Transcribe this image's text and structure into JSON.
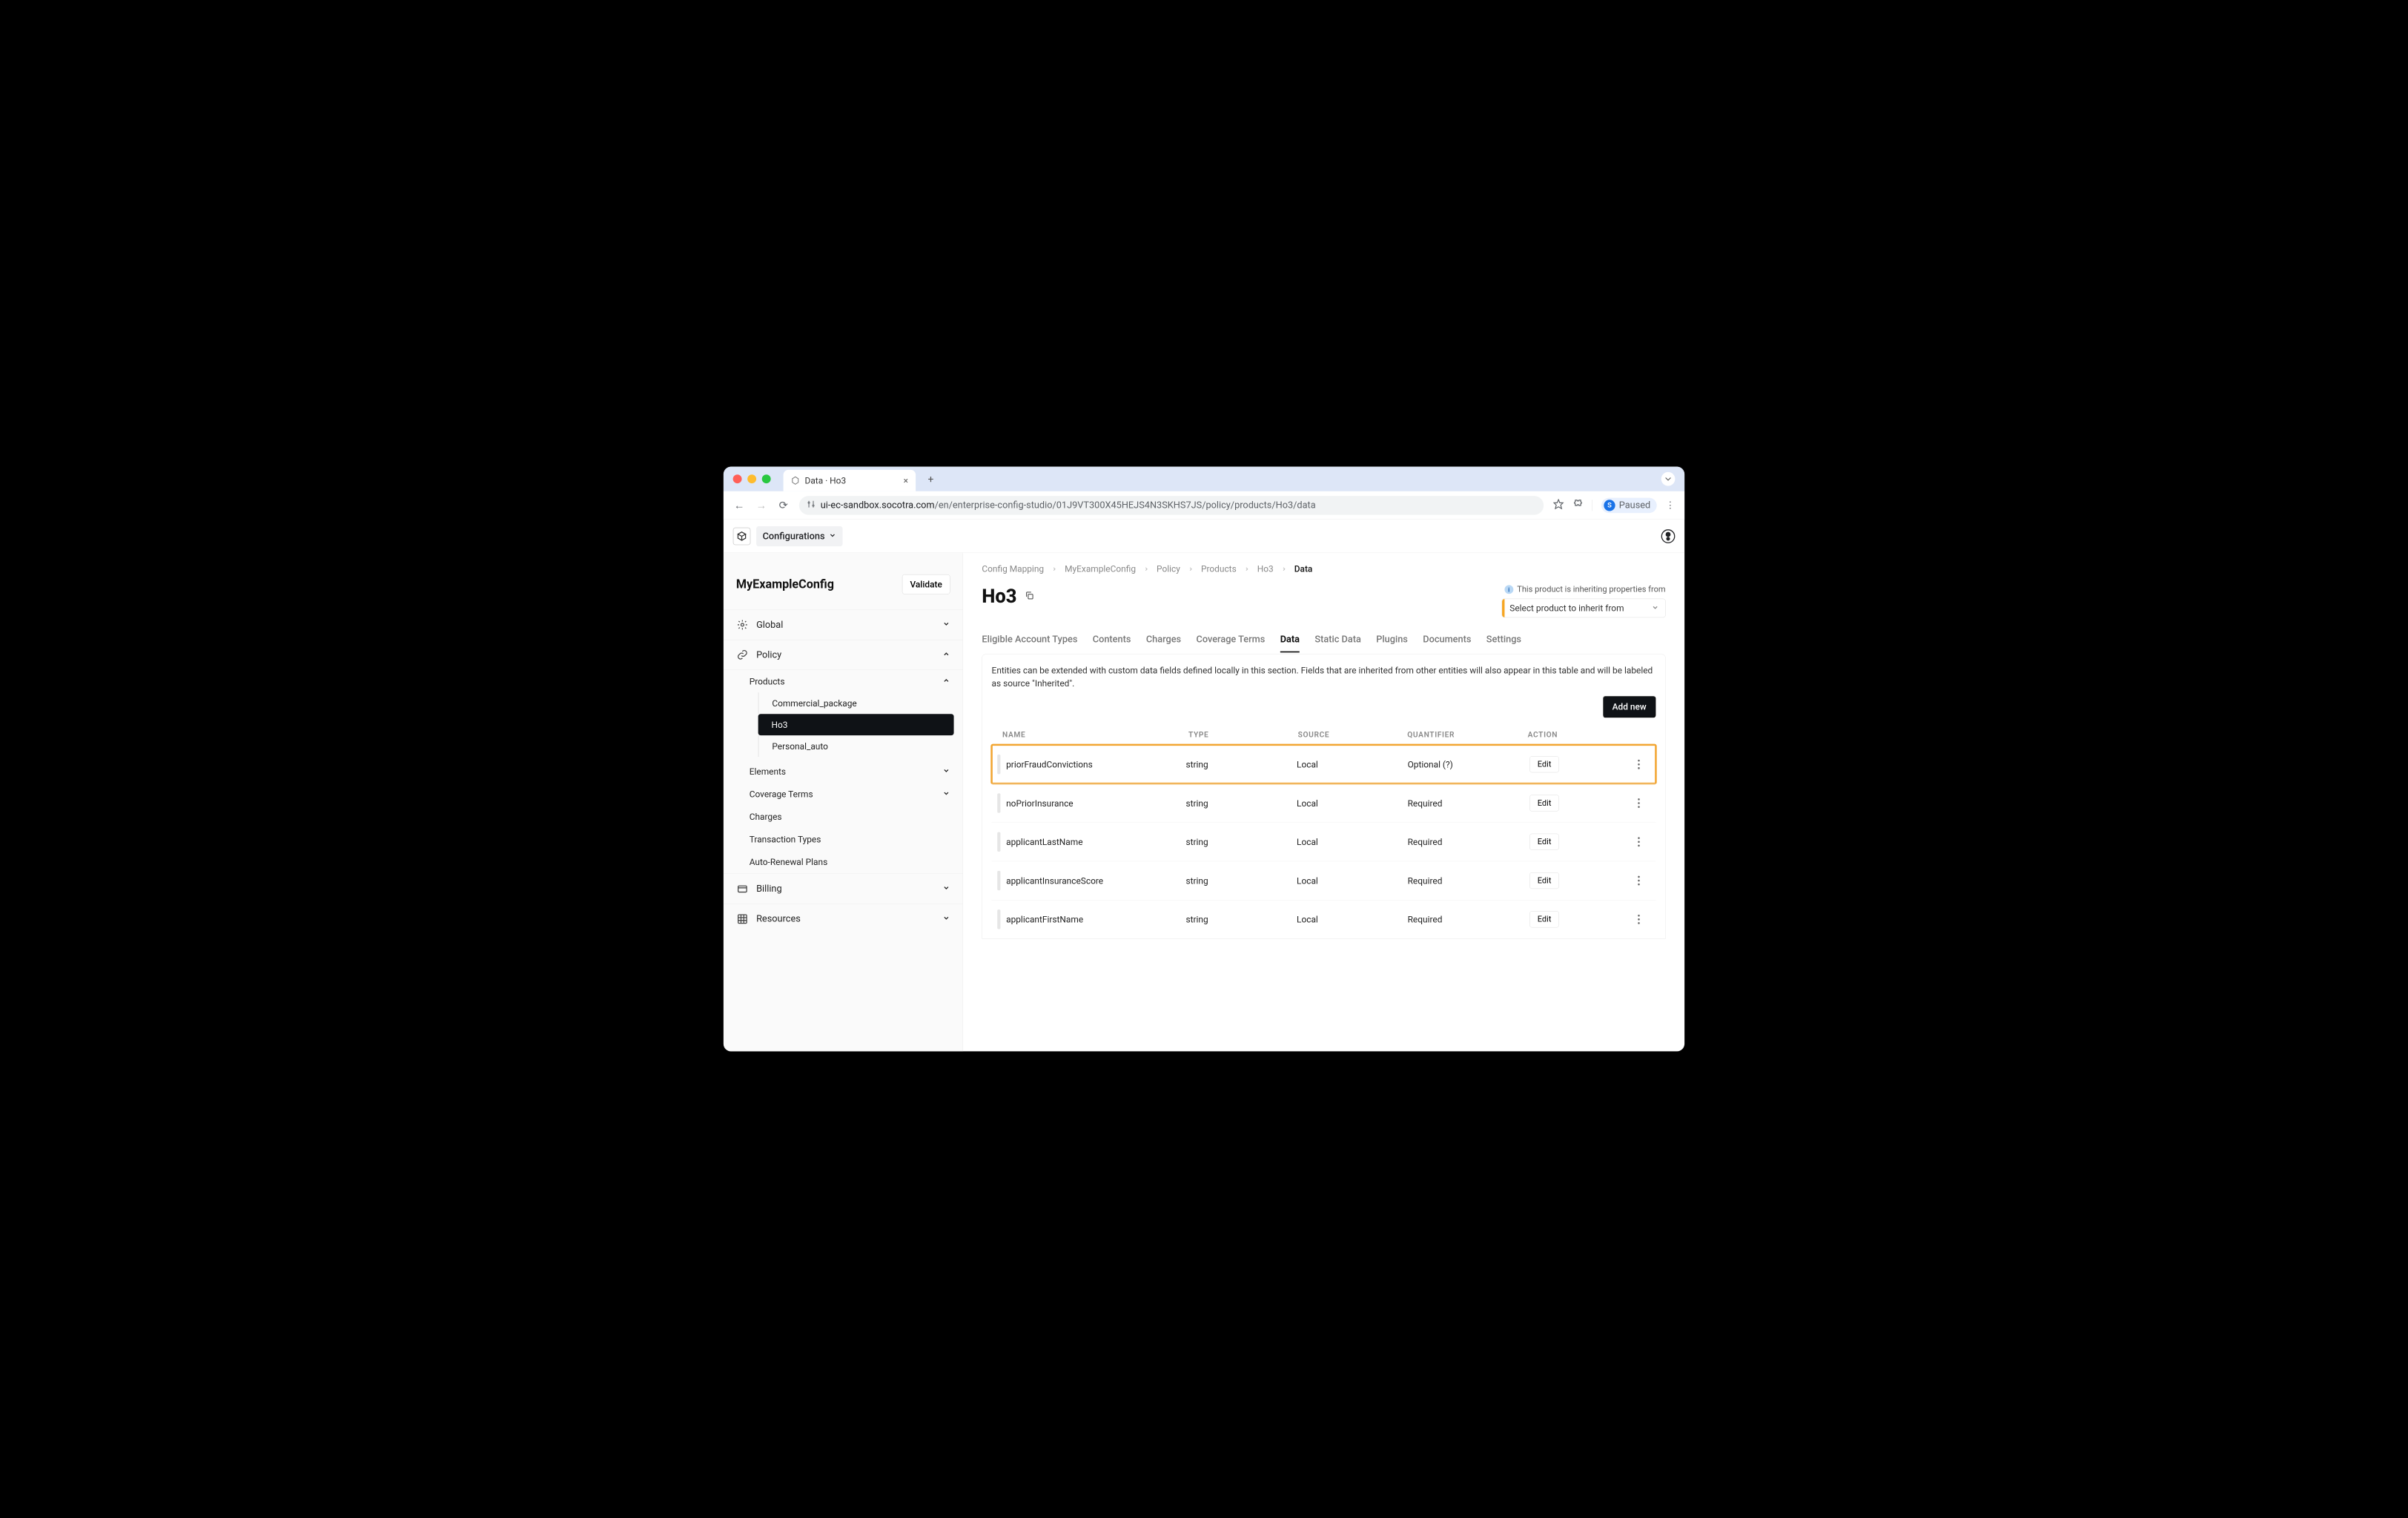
{
  "browser": {
    "tab_title": "Data · Ho3",
    "url_prefix": "ui-ec-sandbox.socotra.com",
    "url_path": "/en/enterprise-config-studio/01J9VT300X45HEJS4N3SKHS7JS/policy/products/Ho3/data",
    "paused_label": "Paused",
    "paused_initial": "S"
  },
  "header": {
    "config_dropdown": "Configurations"
  },
  "sidebar": {
    "project_name": "MyExampleConfig",
    "validate": "Validate",
    "global": "Global",
    "policy": "Policy",
    "products": "Products",
    "product_items": [
      "Commercial_package",
      "Ho3",
      "Personal_auto"
    ],
    "elements": "Elements",
    "coverage_terms": "Coverage Terms",
    "charges": "Charges",
    "transaction_types": "Transaction Types",
    "auto_renewal": "Auto-Renewal Plans",
    "billing": "Billing",
    "resources": "Resources"
  },
  "breadcrumb": [
    "Config Mapping",
    "MyExampleConfig",
    "Policy",
    "Products",
    "Ho3",
    "Data"
  ],
  "page": {
    "title": "Ho3",
    "inherit_note": "This product is inheriting properties from",
    "inherit_placeholder": "Select product to inherit from"
  },
  "tabs": [
    "Eligible Account Types",
    "Contents",
    "Charges",
    "Coverage Terms",
    "Data",
    "Static Data",
    "Plugins",
    "Documents",
    "Settings"
  ],
  "active_tab": "Data",
  "panel": {
    "description": "Entities can be extended with custom data fields defined locally in this section. Fields that are inherited from other entities will also appear in this table and will be labeled as source \"Inherited\".",
    "add_new": "Add new",
    "columns": {
      "name": "NAME",
      "type": "TYPE",
      "source": "SOURCE",
      "quantifier": "QUANTIFIER",
      "action": "ACTION"
    },
    "edit_label": "Edit",
    "rows": [
      {
        "name": "priorFraudConvictions",
        "type": "string",
        "source": "Local",
        "quantifier": "Optional (?)",
        "highlighted": true
      },
      {
        "name": "noPriorInsurance",
        "type": "string",
        "source": "Local",
        "quantifier": "Required"
      },
      {
        "name": "applicantLastName",
        "type": "string",
        "source": "Local",
        "quantifier": "Required"
      },
      {
        "name": "applicantInsuranceScore",
        "type": "string",
        "source": "Local",
        "quantifier": "Required"
      },
      {
        "name": "applicantFirstName",
        "type": "string",
        "source": "Local",
        "quantifier": "Required"
      }
    ]
  }
}
